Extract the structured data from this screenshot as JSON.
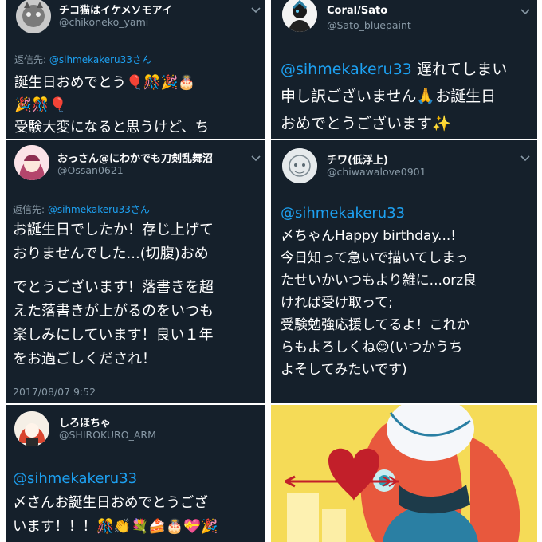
{
  "colors": {
    "background": "#15202b",
    "text": "#ffffff",
    "secondary": "#8899a6",
    "link": "#1da1f2"
  },
  "tweets": [
    {
      "display_name": "チコ猫はイケメソモアイ",
      "handle": "@chikoneko_yami",
      "reply_label": "返信先: ",
      "reply_to": "@sihmekakeru33さん",
      "lines": [
        "誕生日おめでとう🎈🎊🎉🎂",
        "🎉🎊🎈",
        "受験大変になると思うけど、ち"
      ],
      "avatar_icon": "cat-avatar-icon"
    },
    {
      "display_name": "Coral/Sato",
      "handle": "@Sato_bluepaint",
      "mention": "@sihmekakeru33",
      "line1_rest": " 遅れてしまい",
      "lines": [
        "申し訳ございません🙏お誕生日",
        "おめでとうございます✨"
      ],
      "avatar_icon": "character-avatar-icon"
    },
    {
      "display_name": "おっさん@にわかでも刀剣乱舞沼",
      "handle": "@Ossan0621",
      "reply_label": "返信先: ",
      "reply_to": "@sihmekakeru33さん",
      "lines": [
        "お誕生日でしたか！存じ上げて",
        "おりませんでした...(切腹)おめ",
        "でとうございます！落書きを超",
        "えた落書きが上がるのをいつも",
        "楽しみにしています！良い１年",
        "をお過ごしくだされ！"
      ],
      "timestamp": "2017/08/07 9:52",
      "avatar_icon": "anime-girl-avatar-icon"
    },
    {
      "display_name": "チワ(低浮上)",
      "handle": "@chiwawalove0901",
      "mention": "@sihmekakeru33",
      "lines": [
        "〆ちゃんHappy birthday...!",
        "今日知って急いで描いてしまっ",
        "たせいかいつもより雑に...orz良",
        "ければ受け取って;",
        "受験勉強応援してるよ！これか",
        "らもよろしくね😊(いつかうち",
        "よそしてみたいです)"
      ],
      "avatar_icon": "sketch-avatar-icon"
    },
    {
      "display_name": "しろほちゃ",
      "handle": "@SHIROKURO_ARM",
      "mention": "@sihmekakeru33",
      "lines": [
        "〆さんお誕生日おめでとうござ",
        "います！！！🎊👏💐🍰🎂💝🎉"
      ],
      "avatar_icon": "red-hair-avatar-icon"
    }
  ],
  "artwork": {
    "description_icon": "fanart-illustration",
    "palette": [
      "#f4d63c",
      "#c21f2a",
      "#2a7fa3",
      "#e8583d"
    ]
  }
}
